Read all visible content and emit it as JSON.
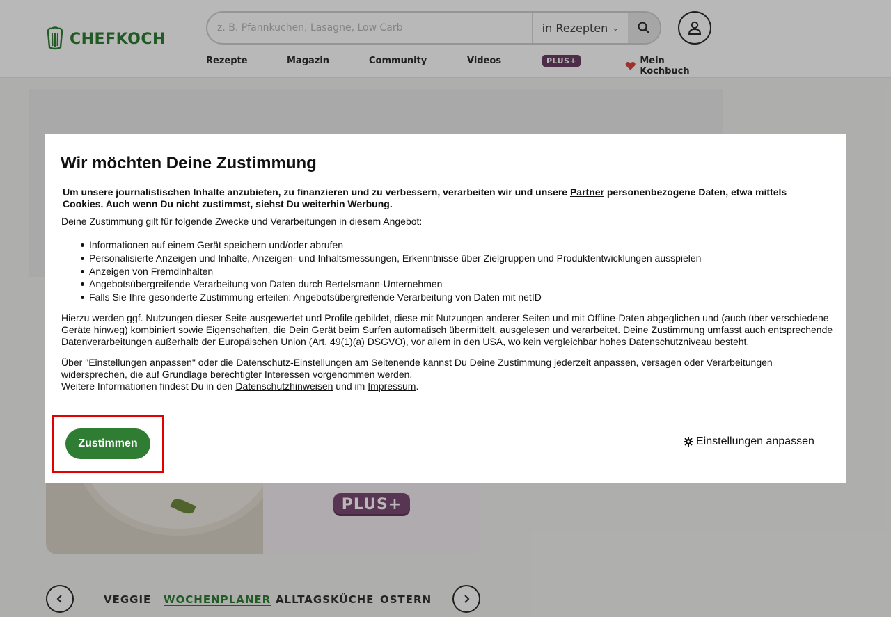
{
  "header": {
    "logo_text": "CHEFKOCH",
    "search": {
      "placeholder": "z. B. Pfannkuchen, Lasagne, Low Carb",
      "scope": "in Rezepten"
    },
    "nav": {
      "items": [
        "Rezepte",
        "Magazin",
        "Community",
        "Videos"
      ],
      "plus_badge": "PLUS+",
      "kochbuch": "Mein Kochbuch"
    }
  },
  "teaser": {
    "badge": "PLUS+"
  },
  "categories": {
    "items": [
      "VEGGIE",
      "WOCHENPLANER",
      "ALLTAGSKÜCHE",
      "OSTERN"
    ],
    "active": "WOCHENPLANER"
  },
  "consent": {
    "title": "Wir möchten Deine Zustimmung",
    "intro_before": "Um unsere journalistischen Inhalte anzubieten, zu finanzieren und zu verbessern, verarbeiten wir und unsere ",
    "intro_link": "Partner",
    "intro_after": " personenbezogene Daten, etwa mittels Cookies. Auch wenn Du nicht zustimmst, siehst Du weiterhin Werbung.",
    "purposes_label": "Deine Zustimmung gilt für folgende Zwecke und Verarbeitungen in diesem Angebot:",
    "purposes": [
      "Informationen auf einem Gerät speichern und/oder abrufen",
      "Personalisierte Anzeigen und Inhalte, Anzeigen- und Inhaltsmessungen, Erkenntnisse über Zielgruppen und Produktentwicklungen ausspielen",
      "Anzeigen von Fremdinhalten",
      "Angebotsübergreifende Verarbeitung von Daten durch Bertelsmann-Unternehmen",
      "Falls Sie Ihre gesonderte Zustimmung erteilen: Angebotsübergreifende Verarbeitung von Daten mit netID"
    ],
    "paragraph1": "Hierzu werden ggf. Nutzungen dieser Seite ausgewertet und Profile gebildet, diese mit Nutzungen anderer Seiten und mit Offline-Daten abgeglichen und (auch über verschiedene Geräte hinweg) kombiniert sowie Eigenschaften, die Dein Gerät beim Surfen automatisch übermittelt, ausgelesen und verarbeitet. Deine Zustimmung umfasst auch entsprechende Datenverarbeitungen außerhalb der Europäischen Union (Art. 49(1)(a) DSGVO), vor allem in den USA, wo kein vergleichbar hohes Datenschutzniveau besteht.",
    "paragraph2": "Über \"Einstellungen anpassen\" oder die Datenschutz-Einstellungen am Seitenende kannst Du Deine Zustimmung jederzeit anpassen, versagen oder Verarbeitungen widersprechen, die auf Grundlage berechtigter Interessen vorgenommen werden.",
    "more_before": "Weitere Informationen findest Du in den ",
    "more_link1": "Datenschutzhinweisen",
    "more_middle": " und im ",
    "more_link2": "Impressum",
    "more_after": ".",
    "accept_label": "Zustimmen",
    "settings_label": "Einstellungen anpassen"
  },
  "colors": {
    "brand_green": "#2e7d32",
    "plus_purple": "#6b3d63",
    "highlight_red": "#e00000"
  }
}
